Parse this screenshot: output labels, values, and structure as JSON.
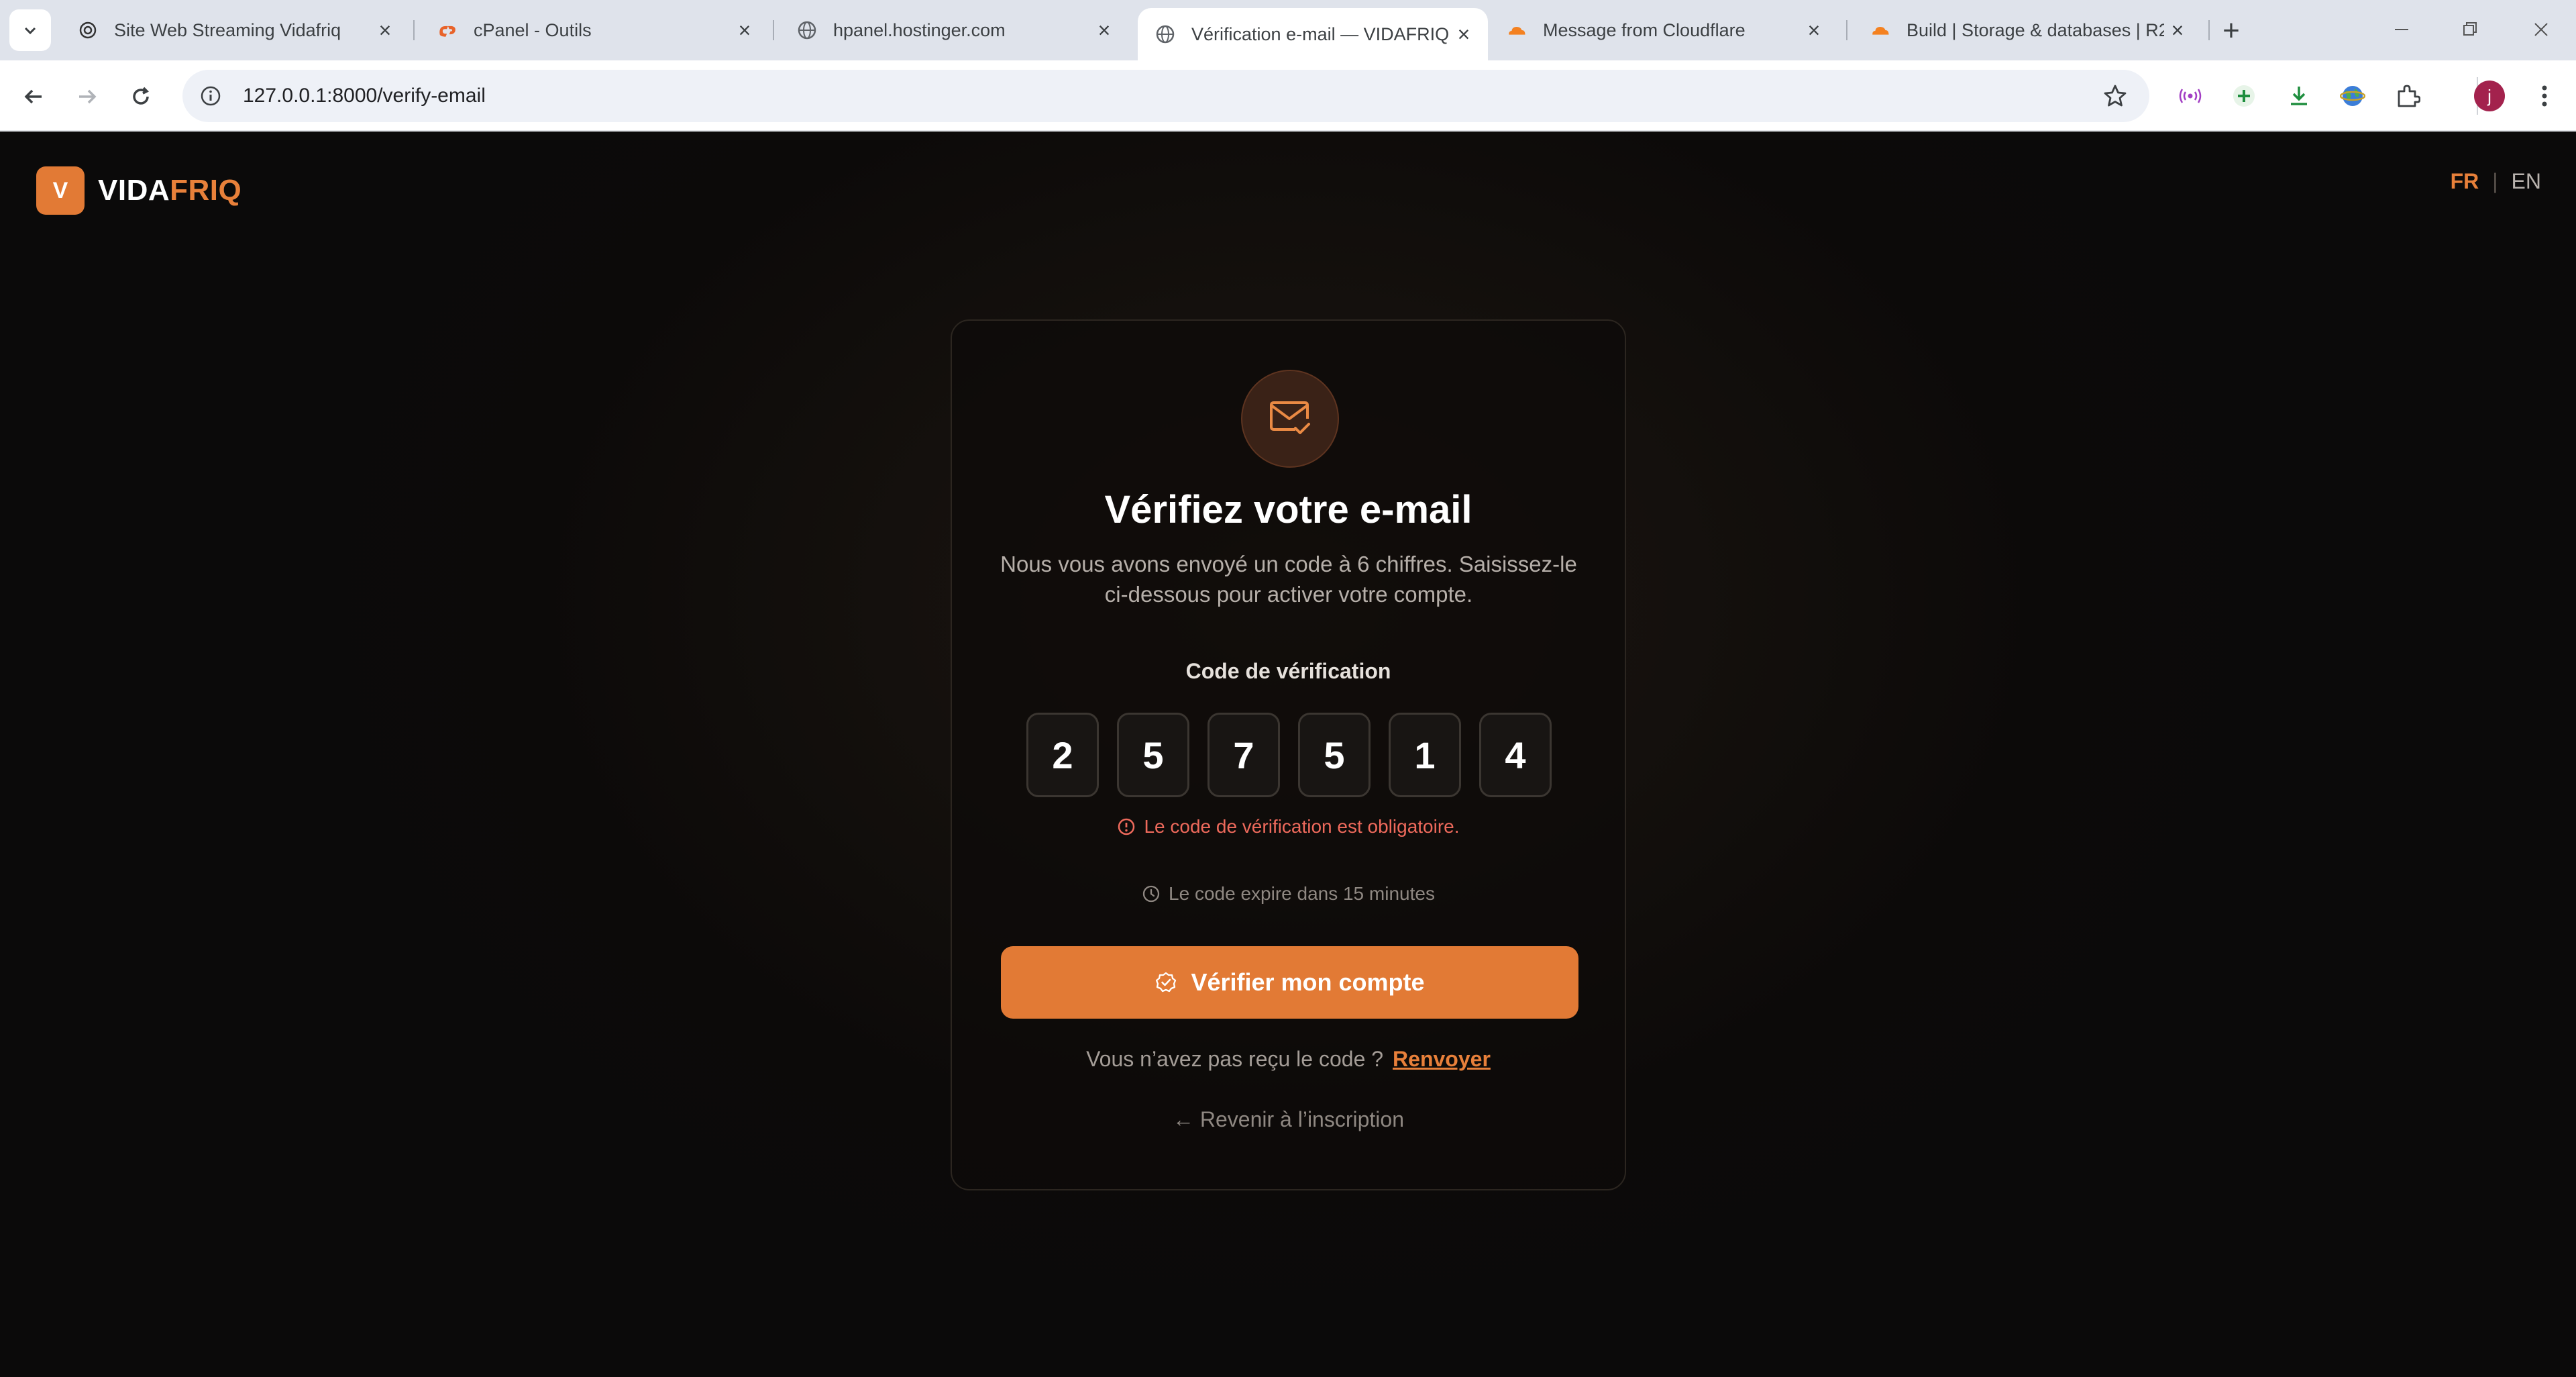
{
  "browser": {
    "tabs": [
      {
        "label": "Site Web Streaming Vidafriq",
        "icon": "chatgpt-icon",
        "active": false
      },
      {
        "label": "cPanel - Outils",
        "icon": "cpanel-icon",
        "active": false
      },
      {
        "label": "hpanel.hostinger.com",
        "icon": "globe-icon",
        "active": false
      },
      {
        "label": "Vérification e-mail — VIDAFRIQ",
        "icon": "globe-icon",
        "active": true
      },
      {
        "label": "Message from Cloudflare",
        "icon": "cloudflare-icon",
        "active": false
      },
      {
        "label": "Build | Storage & databases | R2",
        "icon": "cloudflare-icon",
        "active": false
      }
    ],
    "url": "127.0.0.1:8000/verify-email",
    "profile_initial": "j"
  },
  "header": {
    "logo_letter": "V",
    "brand_part1": "VIDA",
    "brand_part2": "FRIQ",
    "lang_fr": "FR",
    "lang_sep": "|",
    "lang_en": "EN"
  },
  "card": {
    "title": "Vérifiez votre e-mail",
    "subtitle": "Nous vous avons envoyé un code à 6 chiffres. Saisissez-le ci-dessous pour activer votre compte.",
    "code_label": "Code de vérification",
    "digits": [
      "2",
      "5",
      "7",
      "5",
      "1",
      "4"
    ],
    "error": "Le code de vérification est obligatoire.",
    "expiry": "Le code expire dans 15 minutes",
    "verify_button": "Vérifier mon compte",
    "resend_prompt": "Vous n’avez pas reçu le code ?",
    "resend_link": "Renvoyer",
    "back_link": "← Revenir à l’inscription"
  },
  "colors": {
    "accent": "#e27a35",
    "error": "#ef6a5c",
    "background": "#0d0a08"
  }
}
